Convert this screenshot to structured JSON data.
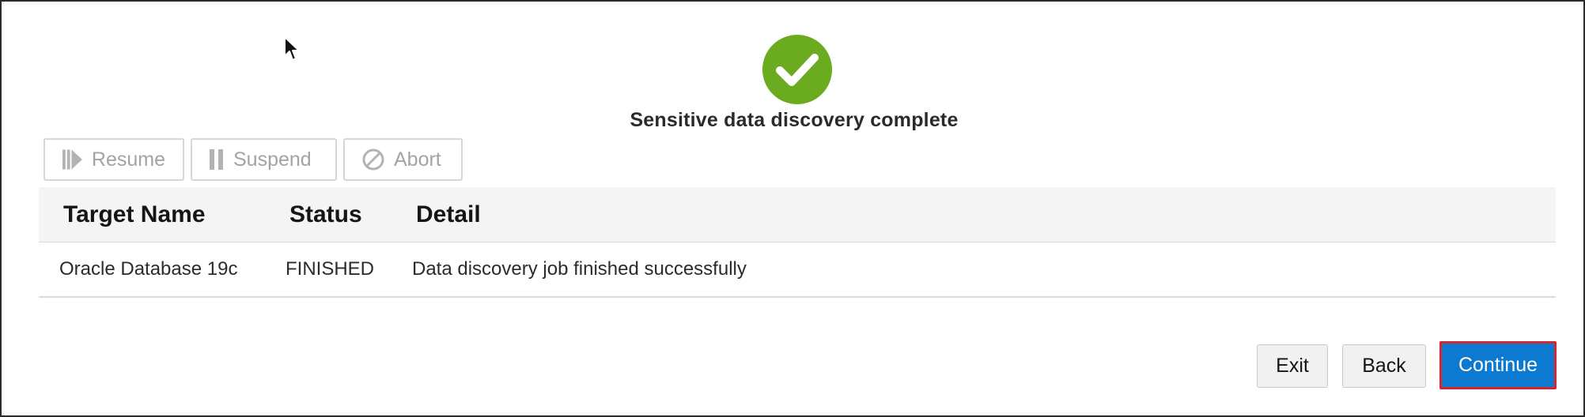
{
  "header": {
    "title": "Sensitive data discovery complete",
    "status_icon": "check-circle-icon",
    "status_color": "#6aab1f"
  },
  "toolbar": {
    "resume_label": "Resume",
    "suspend_label": "Suspend",
    "abort_label": "Abort"
  },
  "table": {
    "columns": [
      "Target Name",
      "Status",
      "Detail"
    ],
    "rows": [
      {
        "target_name": "Oracle Database 19c",
        "status": "FINISHED",
        "detail": "Data discovery job finished successfully"
      }
    ]
  },
  "footer": {
    "exit_label": "Exit",
    "back_label": "Back",
    "continue_label": "Continue"
  },
  "colors": {
    "primary_button": "#0b7ad0",
    "highlight_border": "#d7262b",
    "success": "#6aab1f"
  }
}
